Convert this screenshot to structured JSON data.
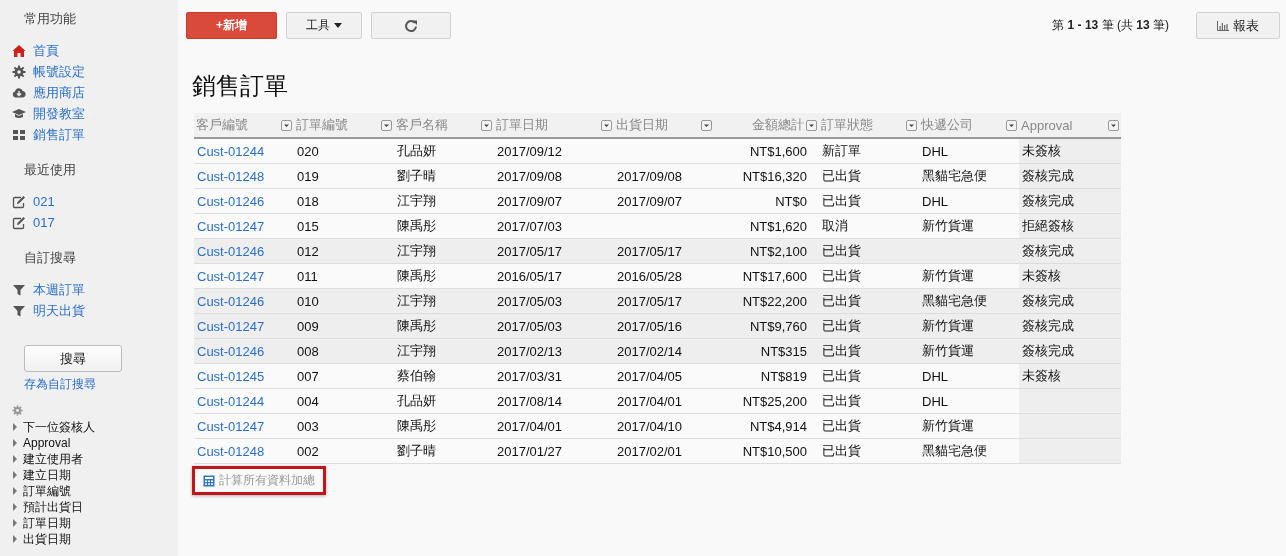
{
  "sidebar": {
    "sections": [
      {
        "title": "常用功能",
        "items": [
          {
            "kind": "home",
            "label": "首頁"
          },
          {
            "kind": "gear",
            "label": "帳號設定"
          },
          {
            "kind": "cloud",
            "label": "應用商店"
          },
          {
            "kind": "cap",
            "label": "開發教室"
          },
          {
            "kind": "grid",
            "label": "銷售訂單"
          }
        ]
      },
      {
        "title": "最近使用",
        "items": [
          {
            "kind": "edit",
            "label": "021"
          },
          {
            "kind": "edit",
            "label": "017"
          }
        ]
      },
      {
        "title": "自訂搜尋",
        "items": [
          {
            "kind": "filter",
            "label": "本週訂單"
          },
          {
            "kind": "filter",
            "label": "明天出貨"
          }
        ]
      }
    ],
    "search_button": "搜尋",
    "save_search_link": "存為自訂搜尋",
    "fields": [
      "下一位簽核人",
      "Approval",
      "建立使用者",
      "建立日期",
      "訂單編號",
      "預計出貨日",
      "訂單日期",
      "出貨日期"
    ]
  },
  "toolbar": {
    "new_button": "+新增",
    "tools_button": "工具",
    "pagination": "第 **1 - 13** 筆 (共 **13** 筆)",
    "report_button": "報表"
  },
  "page_title": "銷售訂單",
  "table": {
    "columns": [
      "客戶編號",
      "訂單編號",
      "客戶名稱",
      "訂單日期",
      "出貨日期",
      "金額總計",
      "訂單狀態",
      "快遞公司",
      "Approval"
    ],
    "rows": [
      {
        "shaded": false,
        "cells": [
          "Cust-01244",
          "020",
          "孔品妍",
          "2017/09/12",
          "",
          "NT$1,600",
          "新訂單",
          "DHL",
          "未簽核"
        ]
      },
      {
        "shaded": false,
        "cells": [
          "Cust-01248",
          "019",
          "劉子晴",
          "2017/09/08",
          "2017/09/08",
          "NT$16,320",
          "已出貨",
          "黑貓宅急便",
          "簽核完成"
        ]
      },
      {
        "shaded": false,
        "cells": [
          "Cust-01246",
          "018",
          "江宇翔",
          "2017/09/07",
          "2017/09/07",
          "NT$0",
          "已出貨",
          "DHL",
          "簽核完成"
        ]
      },
      {
        "shaded": false,
        "cells": [
          "Cust-01247",
          "015",
          "陳禹彤",
          "2017/07/03",
          "",
          "NT$1,620",
          "取消",
          "新竹貨運",
          "拒絕簽核"
        ]
      },
      {
        "shaded": true,
        "cells": [
          "Cust-01246",
          "012",
          "江宇翔",
          "2017/05/17",
          "2017/05/17",
          "NT$2,100",
          "已出貨",
          "",
          "簽核完成"
        ]
      },
      {
        "shaded": false,
        "cells": [
          "Cust-01247",
          "011",
          "陳禹彤",
          "2016/05/17",
          "2016/05/28",
          "NT$17,600",
          "已出貨",
          "新竹貨運",
          "未簽核"
        ]
      },
      {
        "shaded": true,
        "cells": [
          "Cust-01246",
          "010",
          "江宇翔",
          "2017/05/03",
          "2017/05/17",
          "NT$22,200",
          "已出貨",
          "黑貓宅急便",
          "簽核完成"
        ]
      },
      {
        "shaded": true,
        "cells": [
          "Cust-01247",
          "009",
          "陳禹彤",
          "2017/05/03",
          "2017/05/16",
          "NT$9,760",
          "已出貨",
          "新竹貨運",
          "簽核完成"
        ]
      },
      {
        "shaded": true,
        "cells": [
          "Cust-01246",
          "008",
          "江宇翔",
          "2017/02/13",
          "2017/02/14",
          "NT$315",
          "已出貨",
          "新竹貨運",
          "簽核完成"
        ]
      },
      {
        "shaded": false,
        "cells": [
          "Cust-01245",
          "007",
          "蔡伯翰",
          "2017/03/31",
          "2017/04/05",
          "NT$819",
          "已出貨",
          "DHL",
          "未簽核"
        ]
      },
      {
        "shaded": false,
        "cells": [
          "Cust-01244",
          "004",
          "孔品妍",
          "2017/08/14",
          "2017/04/01",
          "NT$25,200",
          "已出貨",
          "DHL",
          ""
        ]
      },
      {
        "shaded": false,
        "cells": [
          "Cust-01247",
          "003",
          "陳禹彤",
          "2017/04/01",
          "2017/04/10",
          "NT$4,914",
          "已出貨",
          "新竹貨運",
          ""
        ]
      },
      {
        "shaded": false,
        "cells": [
          "Cust-01248",
          "002",
          "劉子晴",
          "2017/01/27",
          "2017/02/01",
          "NT$10,500",
          "已出貨",
          "黑貓宅急便",
          ""
        ]
      }
    ],
    "sum_button": "計算所有資料加總"
  }
}
